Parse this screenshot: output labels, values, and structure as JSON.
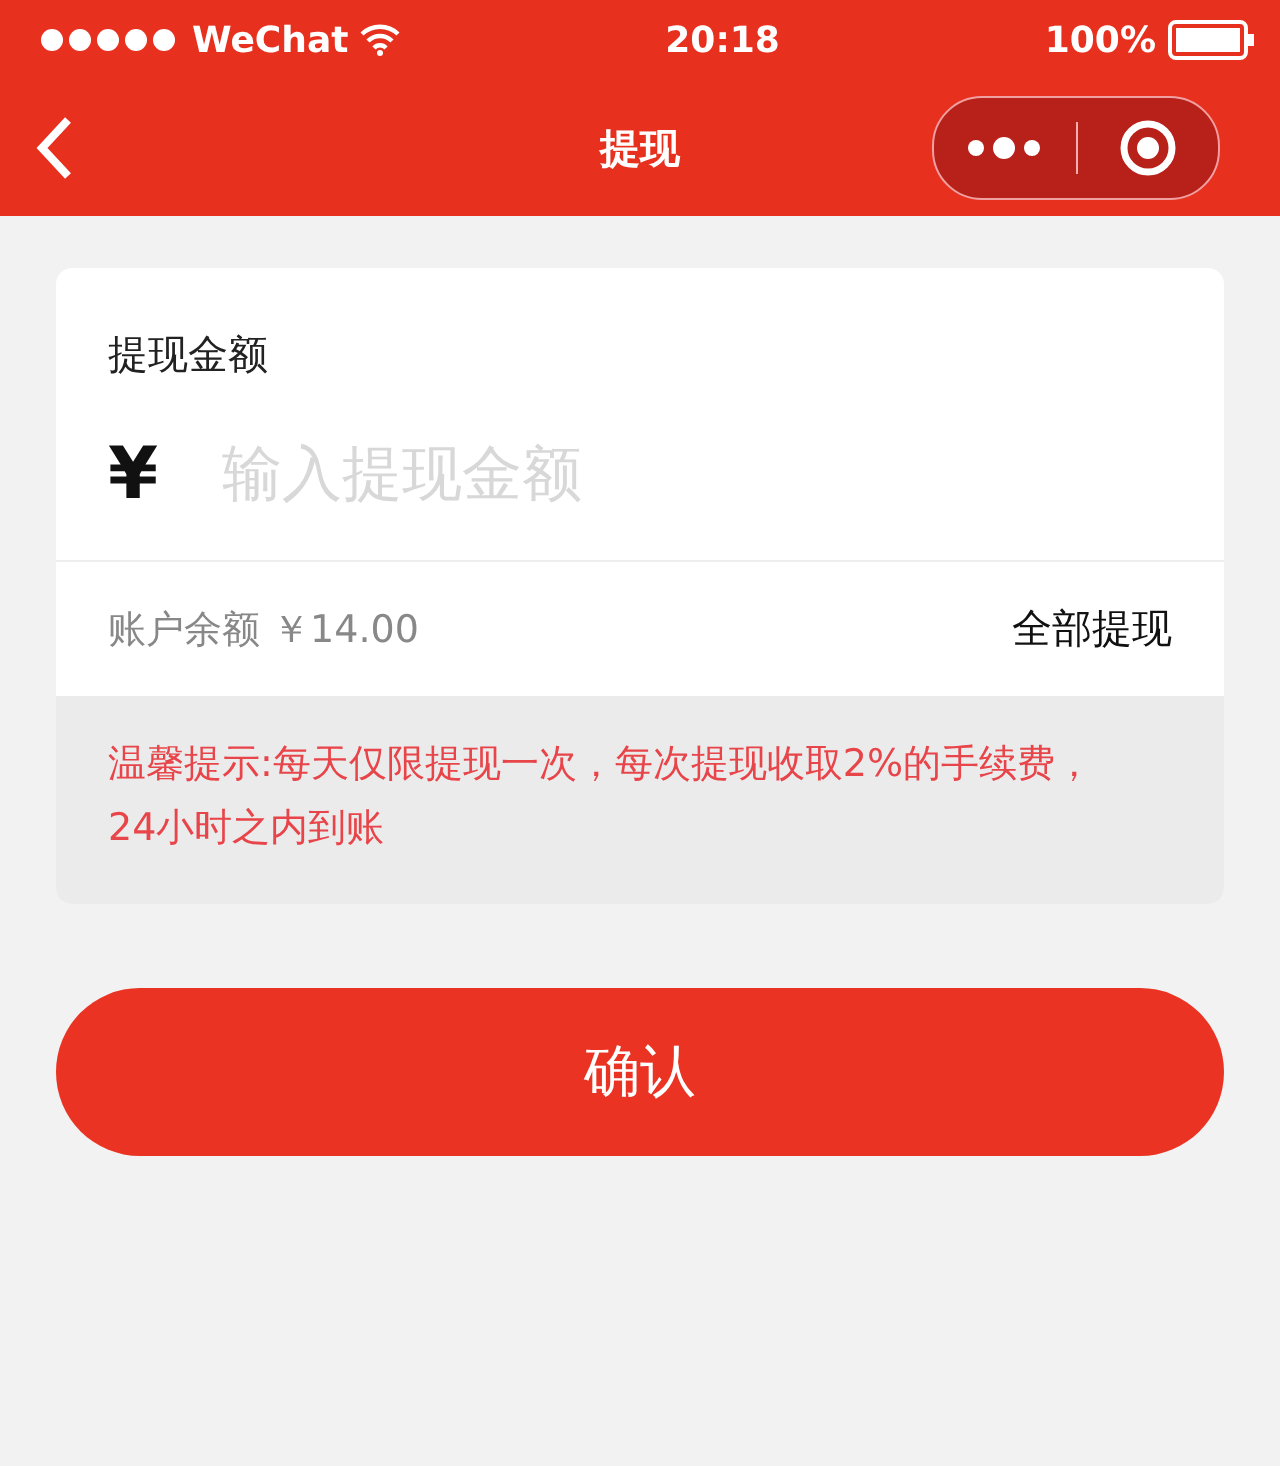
{
  "status_bar": {
    "carrier": "WeChat",
    "time": "20:18",
    "battery": "100%"
  },
  "nav": {
    "title": "提现"
  },
  "form": {
    "label": "提现金额",
    "currency": "¥",
    "amount": {
      "placeholder": "输入提现金额"
    },
    "balance": "账户余额 ￥14.00",
    "withdraw_all": "全部提现",
    "tip": "温馨提示:每天仅限提现一次，每次提现收取2%的手续费，24小时之内到账"
  },
  "confirm_button": "确认"
}
